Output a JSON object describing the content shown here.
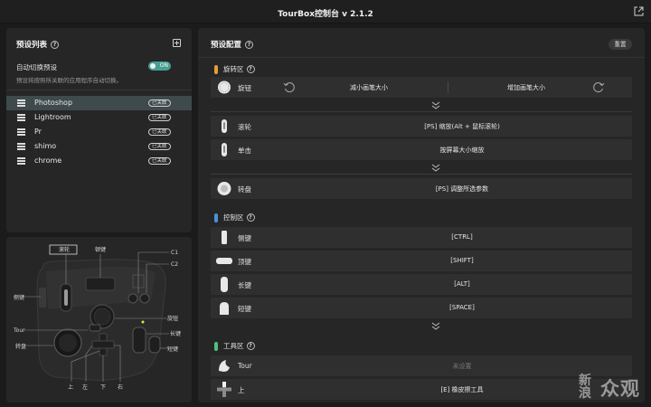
{
  "window": {
    "title": "TourBox控制台 v 2.1.2"
  },
  "preset_list": {
    "title": "预设列表",
    "help": "?",
    "auto_switch_label": "自动切换预设",
    "auto_switch_desc": "预设将按照所关联的应用程序自动切换。",
    "auto_switch_toggle": "ON",
    "items": [
      {
        "name": "Photoshop",
        "badge": "已关联"
      },
      {
        "name": "Lightroom",
        "badge": "已关联"
      },
      {
        "name": "Pr",
        "badge": "已关联"
      },
      {
        "name": "shimo",
        "badge": "已关联"
      },
      {
        "name": "chrome",
        "badge": "已关联"
      }
    ]
  },
  "device_map": {
    "labels": {
      "scroll": "滚轮",
      "side_top": "顿键",
      "c1": "C1",
      "c2": "C2",
      "side": "侧键",
      "knob": "旋钮",
      "tour": "Tour",
      "long": "长键",
      "dial": "转盘",
      "short": "短键",
      "up": "上",
      "left": "左",
      "down": "下",
      "right": "右"
    }
  },
  "preset_config": {
    "title": "预设配置",
    "help": "?",
    "reset_label": "重置",
    "sections": {
      "rotate": {
        "title": "旋转区",
        "color": "#e89a3c"
      },
      "control": {
        "title": "控制区",
        "color": "#4a90d9"
      },
      "tool": {
        "title": "工具区",
        "color": "#4fbf7f"
      }
    },
    "knob": {
      "label": "旋钮",
      "left": "减小画笔大小",
      "right": "增加画笔大小"
    },
    "scroll": {
      "label": "滚轮",
      "value": "[PS] 缩放(Alt + 鼠标滚轮)"
    },
    "click": {
      "label": "单击",
      "value": "按屏幕大小缩放"
    },
    "dial": {
      "label": "转盘",
      "value": "[PS] 调整所选参数"
    },
    "side": {
      "label": "侧键",
      "value": "[CTRL]"
    },
    "top": {
      "label": "顶键",
      "value": "[SHIFT]"
    },
    "long": {
      "label": "长键",
      "value": "[ALT]"
    },
    "short": {
      "label": "短键",
      "value": "[SPACE]"
    },
    "tour": {
      "label": "Tour",
      "value": "未设置"
    },
    "up": {
      "label": "上",
      "value": "[E] 橡皮擦工具"
    }
  },
  "watermark": {
    "big": "众观",
    "small": "新浪"
  }
}
